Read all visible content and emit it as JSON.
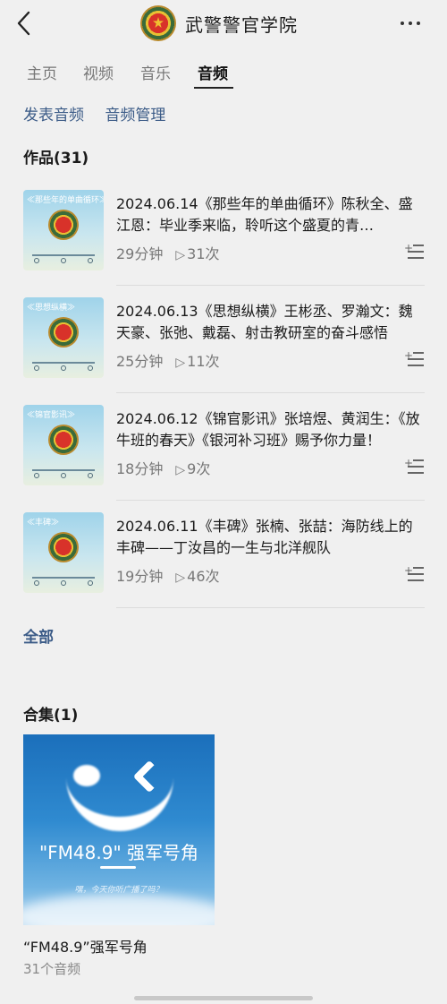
{
  "header": {
    "title": "武警警官学院"
  },
  "tabs": [
    {
      "label": "主页",
      "active": false
    },
    {
      "label": "视频",
      "active": false
    },
    {
      "label": "音乐",
      "active": false
    },
    {
      "label": "音频",
      "active": true
    }
  ],
  "actions": {
    "publish": "发表音频",
    "manage": "音频管理"
  },
  "works": {
    "title": "作品(31)",
    "items": [
      {
        "thumb_label": "≪那些年的单曲循环≫",
        "title": "2024.06.14《那些年的单曲循环》陈秋全、盛江恩：毕业季来临，聆听这个盛夏的青…",
        "duration": "29分钟",
        "plays": "31次"
      },
      {
        "thumb_label": "≪思想纵横≫",
        "title": "2024.06.13《思想纵横》王彬丞、罗瀚文：魏天豪、张弛、戴磊、射击教研室的奋斗感悟",
        "duration": "25分钟",
        "plays": "11次"
      },
      {
        "thumb_label": "≪锦官影讯≫",
        "title": "2024.06.12《锦官影讯》张培煜、黄润生：《放牛班的春天》《银河补习班》赐予你力量！",
        "duration": "18分钟",
        "plays": "9次"
      },
      {
        "thumb_label": "≪丰碑≫",
        "title": "2024.06.11《丰碑》张楠、张喆：海防线上的丰碑——丁汝昌的一生与北洋舰队",
        "duration": "19分钟",
        "plays": "46次"
      }
    ],
    "all_link": "全部"
  },
  "collections": {
    "title": "合集(1)",
    "cover_text": "\"FM48.9\" 强军号角",
    "cover_sub": "嘿，今天你听广播了吗？",
    "name": "“FM48.9”强军号角",
    "count": "31个音频"
  },
  "colors": {
    "link": "#3b5b87",
    "background": "#f0f0f0"
  }
}
